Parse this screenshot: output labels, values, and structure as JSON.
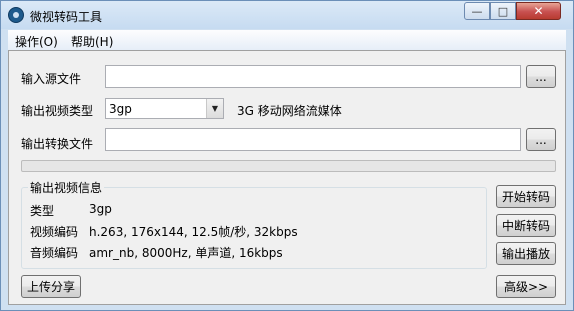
{
  "window": {
    "title": "微视转码工具",
    "controls": {
      "minimize": "—",
      "maximize": "□",
      "close": "✕"
    }
  },
  "menu": {
    "items": [
      "操作(O)",
      "帮助(H)"
    ]
  },
  "form": {
    "input_label": "输入源文件",
    "input_value": "",
    "browse_label": "...",
    "type_label": "输出视频类型",
    "type_selected": "3gp",
    "type_desc": "3G 移动网络流媒体",
    "output_label": "输出转换文件",
    "output_value": ""
  },
  "progress": {
    "value": 0
  },
  "info": {
    "group_title": "输出视频信息",
    "rows": [
      {
        "key": "类型",
        "value": "3gp"
      },
      {
        "key": "视频编码",
        "value": "h.263, 176x144, 12.5帧/秒, 32kbps"
      },
      {
        "key": "音频编码",
        "value": "amr_nb, 8000Hz, 单声道, 16kbps"
      }
    ]
  },
  "actions": {
    "start": "开始转码",
    "stop": "中断转码",
    "play": "输出播放",
    "share": "上传分享",
    "advanced": "高级>>"
  },
  "icons": {
    "app": "app-logo-icon",
    "dropdown": "chevron-down-icon"
  }
}
